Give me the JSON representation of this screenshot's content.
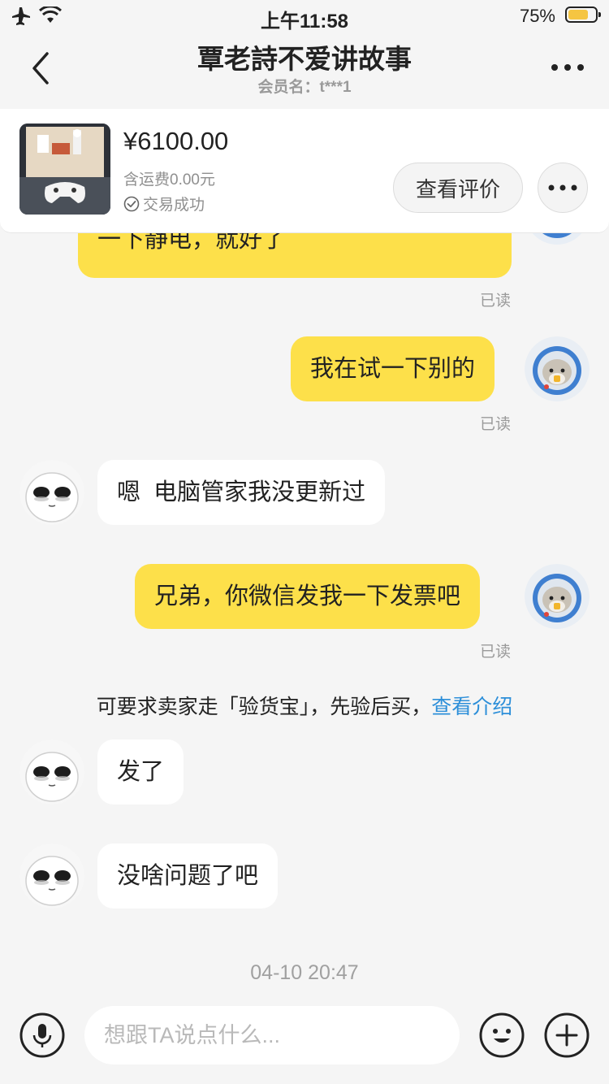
{
  "status_bar": {
    "time": "上午11:58",
    "battery_percent": "75%",
    "battery_level": 0.75,
    "icons": [
      "airplane-icon",
      "wifi-icon",
      "battery-icon"
    ]
  },
  "header": {
    "title": "覃老詩不爱讲故事",
    "member_name": "会员名：t***1",
    "icons": [
      "back-icon",
      "more-icon"
    ]
  },
  "product": {
    "price": "¥6100.00",
    "shipping": "含运费0.00元",
    "status": "交易成功",
    "view_reviews_label": "查看评价"
  },
  "messages": [
    {
      "side": "sent",
      "text": "一下静电，就好了",
      "read": "已读"
    },
    {
      "side": "sent",
      "text": "我在试一下别的",
      "read": "已读"
    },
    {
      "side": "received",
      "text": "嗯  电脑管家我没更新过"
    },
    {
      "side": "sent",
      "text": "兄弟，你微信发我一下发票吧",
      "read": "已读"
    },
    {
      "side": "system",
      "text": "可要求卖家走「验货宝」，先验后买，",
      "link": "查看介绍"
    },
    {
      "side": "received",
      "text": "发了"
    },
    {
      "side": "received",
      "text": "没啥问题了吧"
    }
  ],
  "timestamp": "04-10 20:47",
  "input": {
    "placeholder": "想跟TA说点什么...",
    "value": ""
  },
  "colors": {
    "sent_bubble": "#fde04a",
    "received_bubble": "#ffffff",
    "background": "#f5f5f5",
    "link": "#2d8fd9"
  }
}
